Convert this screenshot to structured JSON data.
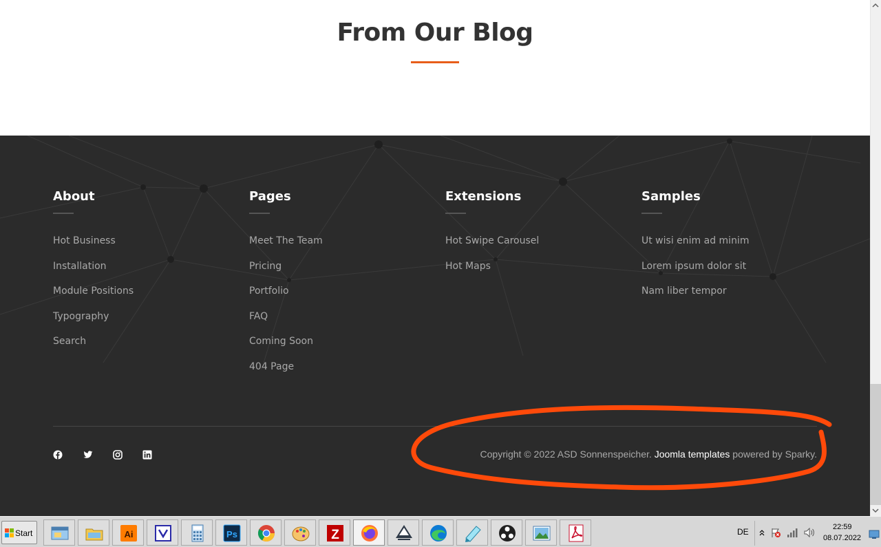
{
  "blog": {
    "title": "From Our Blog"
  },
  "footer": {
    "columns": [
      {
        "title": "About",
        "links": [
          "Hot Business",
          "Installation",
          "Module Positions",
          "Typography",
          "Search"
        ]
      },
      {
        "title": "Pages",
        "links": [
          "Meet The Team",
          "Pricing",
          "Portfolio",
          "FAQ",
          "Coming Soon",
          "404 Page"
        ]
      },
      {
        "title": "Extensions",
        "links": [
          "Hot Swipe Carousel",
          "Hot Maps"
        ]
      },
      {
        "title": "Samples",
        "links": [
          "Ut wisi enim ad minim",
          "Lorem ipsum dolor sit",
          "Nam liber tempor"
        ]
      }
    ],
    "socials": [
      "facebook-icon",
      "twitter-icon",
      "instagram-icon",
      "linkedin-icon"
    ],
    "copyright": {
      "prefix": "Copyright © 2022 ASD Sonnenspeicher.",
      "link": "Joomla templates",
      "suffix": "powered by Sparky."
    }
  },
  "colors": {
    "accent": "#e85d1a",
    "footer_bg": "#2b2b2b",
    "annotation": "#ff4a0a"
  },
  "taskbar": {
    "start_label": "Start",
    "apps": [
      "windows-explorer-icon",
      "file-manager-icon",
      "illustrator-icon",
      "visual-studio-icon",
      "calculator-icon",
      "photoshop-icon",
      "chrome-icon",
      "paint-icon",
      "filezilla-icon",
      "firefox-icon",
      "inkscape-icon",
      "edge-icon",
      "notepad-icon",
      "obs-icon",
      "photos-icon",
      "acrobat-icon"
    ],
    "language": "DE",
    "time": "22:59",
    "date": "08.07.2022"
  }
}
